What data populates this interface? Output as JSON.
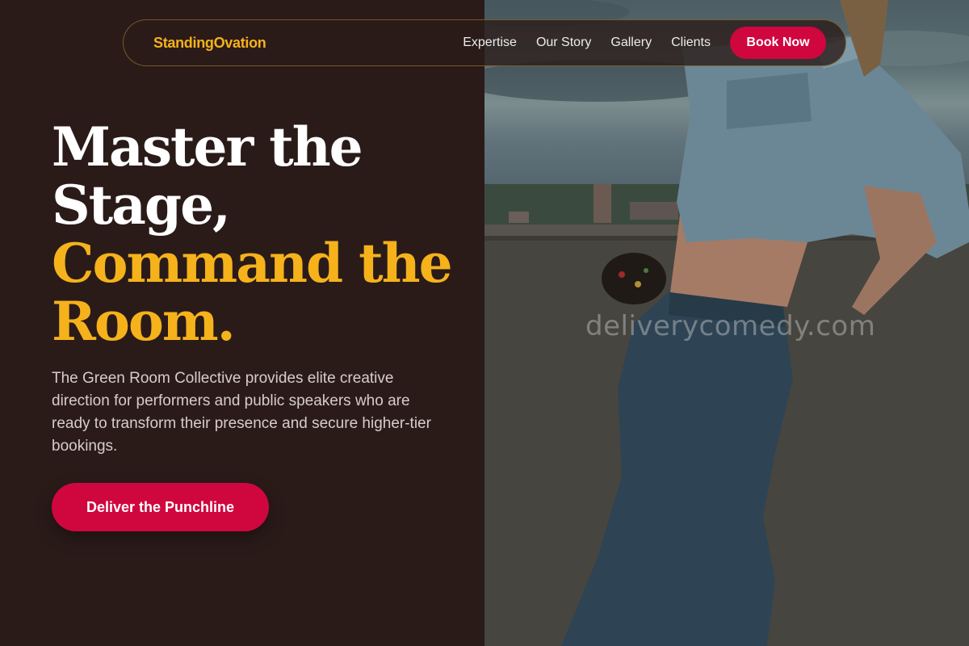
{
  "brand": {
    "name": "StandingOvation"
  },
  "nav": {
    "links": [
      "Expertise",
      "Our Story",
      "Gallery",
      "Clients"
    ],
    "cta_label": "Book Now"
  },
  "hero": {
    "title_line1": "Master the",
    "title_line2": "Stage,",
    "title_line3": "Command the",
    "title_line4": "Room.",
    "description": "The Green Room Collective provides elite creative direction for performers and public speakers who are ready to transform their presence and secure higher-tier bookings.",
    "cta_label": "Deliver the Punchline"
  },
  "watermark": "deliverycomedy.com",
  "colors": {
    "background": "#2a1b19",
    "accent_gold": "#f5b21b",
    "accent_crimson": "#d0063f",
    "text_light": "#d6cdcb"
  }
}
